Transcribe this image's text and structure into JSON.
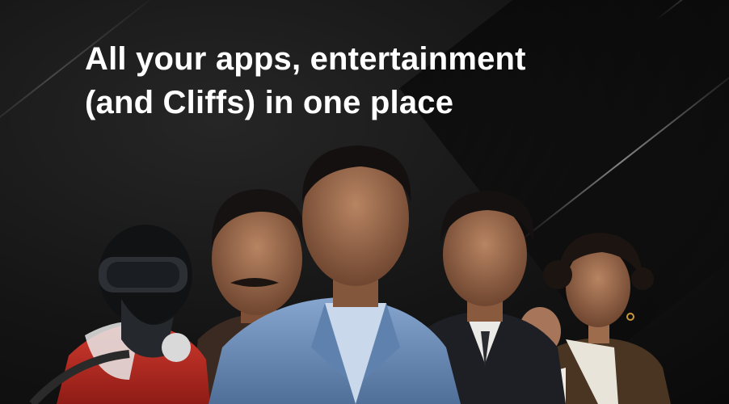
{
  "banner": {
    "headline_line1": "All your apps, entertainment",
    "headline_line2": "(and Cliffs) in one place"
  },
  "colors": {
    "background": "#141414",
    "headline": "#ffffff",
    "blue_suit": "#6d8fb8",
    "black_suit": "#1e1f24",
    "red_jacket": "#b3261e"
  },
  "figures": [
    "diver-figure",
    "mustache-figure",
    "blue-suit-figure",
    "black-suit-figure",
    "costume-figure"
  ]
}
